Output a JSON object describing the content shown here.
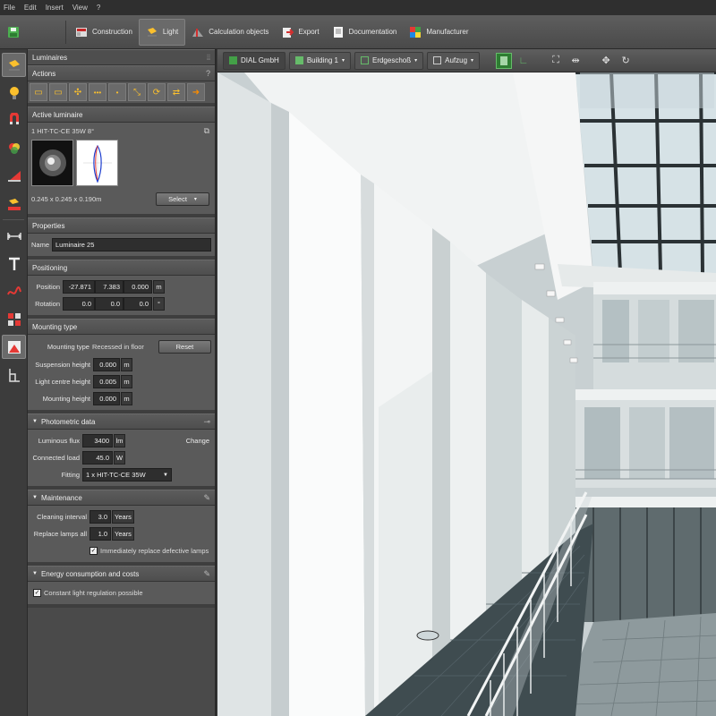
{
  "menu": [
    "File",
    "Edit",
    "Insert",
    "View",
    "?"
  ],
  "toolbar": {
    "items": [
      {
        "label": "Construction",
        "icon": "construction-icon"
      },
      {
        "label": "Light",
        "icon": "light-icon",
        "active": true
      },
      {
        "label": "Calculation objects",
        "icon": "calculation-icon"
      },
      {
        "label": "Export",
        "icon": "export-icon"
      },
      {
        "label": "Documentation",
        "icon": "documentation-icon"
      },
      {
        "label": "Manufacturer",
        "icon": "manufacturer-icon"
      }
    ]
  },
  "panel": {
    "title": "Luminaires",
    "actions_title": "Actions",
    "active": {
      "title": "Active luminaire",
      "name": "1 HIT-TC-CE 35W 8°",
      "dims": "0.245 x 0.245 x 0.190m",
      "select_label": "Select"
    },
    "properties": {
      "title": "Properties",
      "name_label": "Name",
      "name_value": "Luminaire 25"
    },
    "positioning": {
      "title": "Positioning",
      "position_label": "Position",
      "position": [
        "-27.871",
        "7.383",
        "0.000"
      ],
      "position_unit": "m",
      "rotation_label": "Rotation",
      "rotation": [
        "0.0",
        "0.0",
        "0.0"
      ],
      "rotation_unit": "°"
    },
    "mounting": {
      "title": "Mounting type",
      "type_label": "Mounting type",
      "type_value": "Recessed in floor",
      "reset_label": "Reset",
      "suspension_label": "Suspension height",
      "suspension": "0.000",
      "centre_label": "Light centre height",
      "centre": "0.005",
      "mounting_label": "Mounting height",
      "mounting": "0.000",
      "unit": "m"
    },
    "photometric": {
      "title": "Photometric data",
      "flux_label": "Luminous flux",
      "flux": "3400",
      "flux_unit": "lm",
      "change_label": "Change",
      "load_label": "Connected load",
      "load": "45.0",
      "load_unit": "W",
      "fitting_label": "Fitting",
      "fitting": "1 x HIT-TC-CE  35W"
    },
    "maintenance": {
      "title": "Maintenance",
      "cleaning_label": "Cleaning interval",
      "cleaning": "3.0",
      "cleaning_unit": "Years",
      "replace_label": "Replace lamps all",
      "replace": "1.0",
      "replace_unit": "Years",
      "defective_label": "Immediately replace defective lamps"
    },
    "energy": {
      "title": "Energy consumption and costs",
      "constant_label": "Constant light regulation possible"
    }
  },
  "viewport": {
    "crumbs": [
      "DIAL GmbH",
      "Building 1",
      "Erdgeschoß",
      "Aufzug"
    ]
  }
}
